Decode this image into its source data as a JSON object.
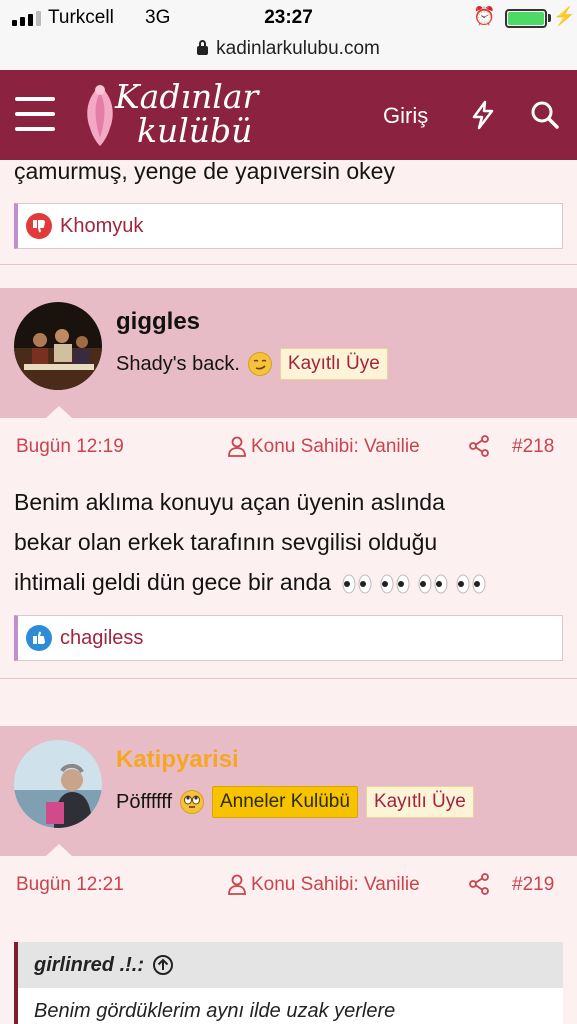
{
  "status": {
    "carrier": "Turkcell",
    "network": "3G",
    "time": "23:27"
  },
  "browser": {
    "url": "kadinlarkulubu.com"
  },
  "navbar": {
    "logo_line1": "Kadınlar",
    "logo_line2": "kulübü",
    "login_label": "Giriş",
    "brand_color": "#8b2340"
  },
  "posts": [
    {
      "text_tail": "çamurmuş, yenge de yapıversin okey",
      "reaction": {
        "type": "thumbs-down",
        "user": "Khomyuk"
      }
    },
    {
      "author": "giggles",
      "user_title": "Shady's back.",
      "badges": [
        "Kayıtlı Üye"
      ],
      "date": "Bugün 12:19",
      "thread_starter": "Konu Sahibi: Vanilie",
      "number": "#218",
      "text": "Benim aklıma konuyu açan üyenin aslında bekar olan erkek tarafının sevgilisi olduğu ihtimali geldi dün gece bir anda",
      "text_lines": [
        "Benim aklıma konuyu açan üyenin aslında",
        "bekar olan erkek tarafının sevgilisi olduğu",
        "ihtimali geldi dün gece bir anda"
      ],
      "reaction": {
        "type": "thumbs-up",
        "user": "chagiless"
      }
    },
    {
      "author": "Katipyarisi",
      "author_color": "#f5a623",
      "user_title": "Pöffffff",
      "badges": [
        "Anneler Kulübü",
        "Kayıtlı Üye"
      ],
      "date": "Bugün 12:21",
      "thread_starter": "Konu Sahibi: Vanilie",
      "number": "#219",
      "quote": {
        "author": "girlinred .!.:",
        "text": "Benim gördüklerim aynı ilde uzak yerlere"
      }
    }
  ]
}
